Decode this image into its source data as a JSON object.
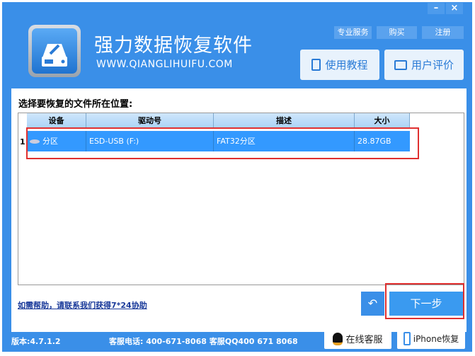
{
  "window": {
    "minimize": "–",
    "close": "×"
  },
  "header": {
    "title": "强力数据恢复软件",
    "url": "WWW.QIANGLIHUIFU.COM",
    "small_buttons": [
      "专业服务",
      "购买",
      "注册"
    ],
    "tutorial": "使用教程",
    "review": "用户评价"
  },
  "main": {
    "prompt": "选择要恢复的文件所在位置:",
    "columns": [
      "设备",
      "驱动号",
      "描述",
      "大小"
    ],
    "rows": [
      {
        "index": "1",
        "device": "分区",
        "drive": "ESD-USB (F:)",
        "description": "FAT32分区",
        "size": "28.87GB"
      }
    ],
    "help_link": "如需帮助，请联系我们获得7*24协助",
    "back": "↶",
    "next": "下一步"
  },
  "footer": {
    "version": "版本:4.7.1.2",
    "contact": "客服电话: 400-671-8068 客服QQ400 671 8068",
    "online": "在线客服",
    "iphone": "iPhone恢复"
  },
  "colors": {
    "brand": "#3a8fe8",
    "selection": "#3399ff",
    "highlight": "#e03030"
  }
}
